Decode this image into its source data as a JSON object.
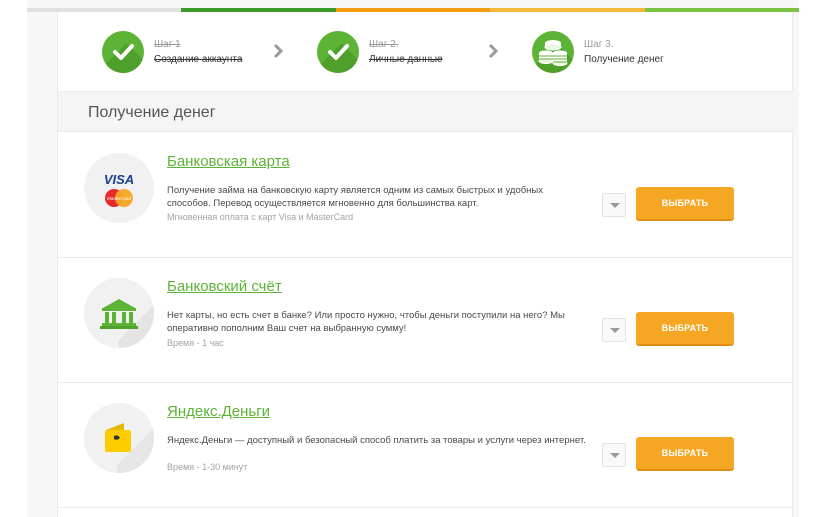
{
  "topbar_colors": [
    "#e0e0e0",
    "#3b9b2a",
    "#f39c12",
    "#f6b93b",
    "#7cc242"
  ],
  "steps": [
    {
      "label": "Шаг 1",
      "name": "Создание аккаунта",
      "status": "done",
      "icon": "checkmark-icon"
    },
    {
      "label": "Шаг 2.",
      "name": "Личные данные",
      "status": "done",
      "icon": "checkmark-icon"
    },
    {
      "label": "Шаг 3.",
      "name": "Получение денег",
      "status": "current",
      "icon": "coins-icon"
    }
  ],
  "section_title": "Получение денег",
  "options": [
    {
      "title": "Банковская карта",
      "description": "Получение займа на банковскую карту является одним из самых быстрых и удобных способов. Перевод осуществляется мгновенно для большинства карт.",
      "note": "Мгновенная оплата с карт Visa и MasterCard",
      "button": "ВЫБРАТЬ",
      "icon": "visa-mastercard-icon",
      "visa_text": "VISA",
      "mastercard_text": "MasterCard"
    },
    {
      "title": "Банковский счёт",
      "description": "Нет карты, но есть счет в банке? Или просто нужно, чтобы деньги поступили на него? Мы оперативно пополним Ваш счет на выбранную сумму!",
      "note": "Время - 1 час",
      "button": "ВЫБРАТЬ",
      "icon": "bank-building-icon"
    },
    {
      "title": "Яндекс.Деньги",
      "description": "Яндекс.Деньги — доступный и безопасный способ платить за товары и услуги через интернет.",
      "note": "Время - 1-30 минут",
      "button": "ВЫБРАТЬ",
      "icon": "yandex-wallet-icon"
    }
  ]
}
